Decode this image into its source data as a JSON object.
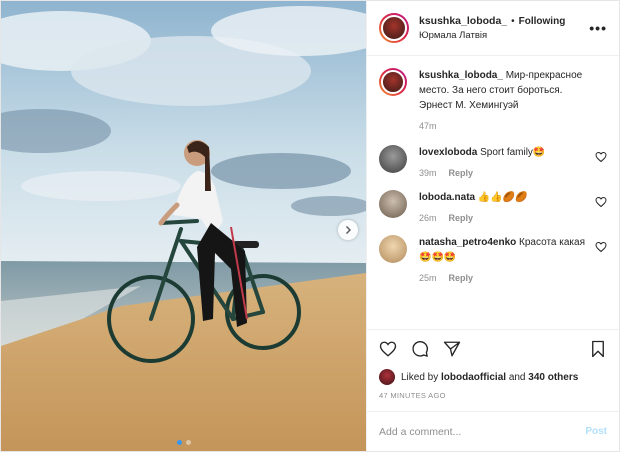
{
  "header": {
    "username": "ksushka_loboda_",
    "separator": "•",
    "follow_label": "Following",
    "location": "Юрмала Латвія"
  },
  "caption": {
    "username": "ksushka_loboda_",
    "text": "Мир-прекрасное место. За него стоит бороться. Эрнест М. Хемингуэй",
    "time": "47m"
  },
  "comments": [
    {
      "username": "lovexloboda",
      "text": "Sport family🤩",
      "time": "39m",
      "reply": "Reply"
    },
    {
      "username": "loboda.nata",
      "text": "👍👍🏉🏉",
      "time": "26m",
      "reply": "Reply"
    },
    {
      "username": "natasha_petro4enko",
      "text": "Красота какая🤩🤩🤩",
      "time": "25m",
      "reply": "Reply"
    }
  ],
  "likes": {
    "prefix": "Liked by",
    "user": "lobodaofficial",
    "connector": "and",
    "others": "340 others"
  },
  "timestamp": "47 MINUTES AGO",
  "add_comment": {
    "placeholder": "Add a comment...",
    "post_label": "Post"
  },
  "carousel": {
    "dots": 2,
    "active": 0
  },
  "colors": {
    "accent": "#3897f0",
    "post_disabled": "#b2dffc",
    "muted": "#8e8e8e"
  }
}
